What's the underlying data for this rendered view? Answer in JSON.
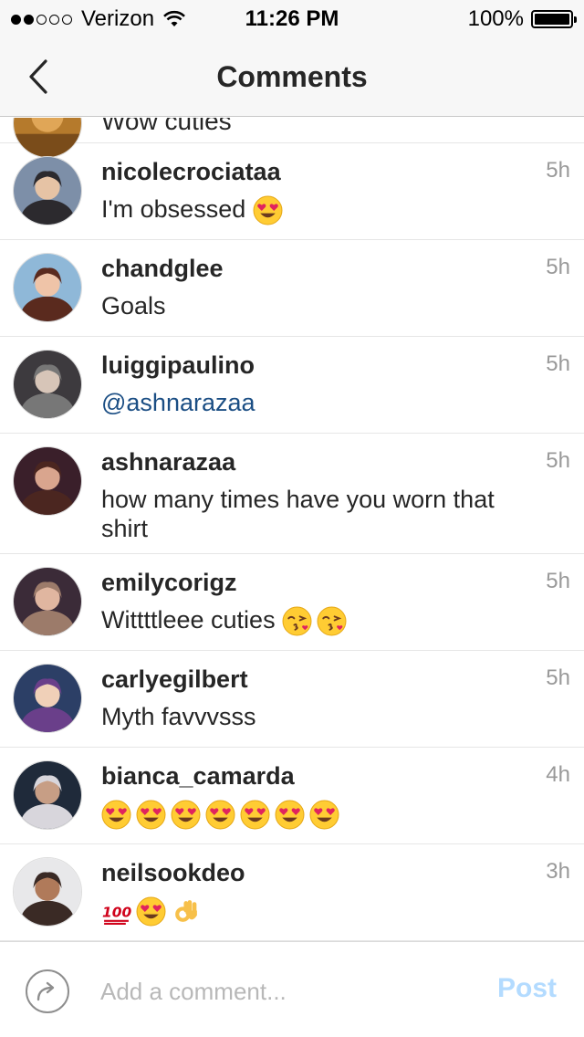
{
  "status_bar": {
    "carrier": "Verizon",
    "time": "11:26 PM",
    "battery": "100%",
    "battery_level": 1.0,
    "signal_bars": 2,
    "signal_total": 5
  },
  "nav": {
    "title": "Comments",
    "back_icon": "chevron-left-icon"
  },
  "partial_comment": {
    "text": "Wow cuties"
  },
  "comments": [
    {
      "username": "nicolecrociataa",
      "text": "I'm obsessed",
      "time": "5h",
      "emojis": [
        "heart-eyes"
      ]
    },
    {
      "username": "chandglee",
      "text": "Goals",
      "time": "5h",
      "emojis": []
    },
    {
      "username": "luiggipaulino",
      "text": "@ashnarazaa",
      "time": "5h",
      "emojis": []
    },
    {
      "username": "ashnarazaa",
      "text": "how many times have you worn that shirt",
      "time": "5h",
      "emojis": []
    },
    {
      "username": "emilycorigz",
      "text": "Wittttleee cuties",
      "time": "5h",
      "emojis": [
        "kiss",
        "kiss"
      ]
    },
    {
      "username": "carlyegilbert",
      "text": "Myth favvvsss",
      "time": "5h",
      "emojis": []
    },
    {
      "username": "bianca_camarda",
      "text": "",
      "time": "4h",
      "emojis": [
        "heart-eyes",
        "heart-eyes",
        "heart-eyes",
        "heart-eyes",
        "heart-eyes",
        "heart-eyes",
        "heart-eyes"
      ]
    },
    {
      "username": "neilsookdeo",
      "text": "",
      "time": "3h",
      "emojis": [
        "hundred",
        "heart-eyes",
        "ok-hand"
      ]
    }
  ],
  "compose": {
    "placeholder": "Add a comment...",
    "post_label": "Post",
    "share_icon": "share-arrow-icon"
  },
  "colors": {
    "mention": "#1b4e84",
    "post_disabled": "#b3dbff",
    "timestamp": "#999999"
  }
}
